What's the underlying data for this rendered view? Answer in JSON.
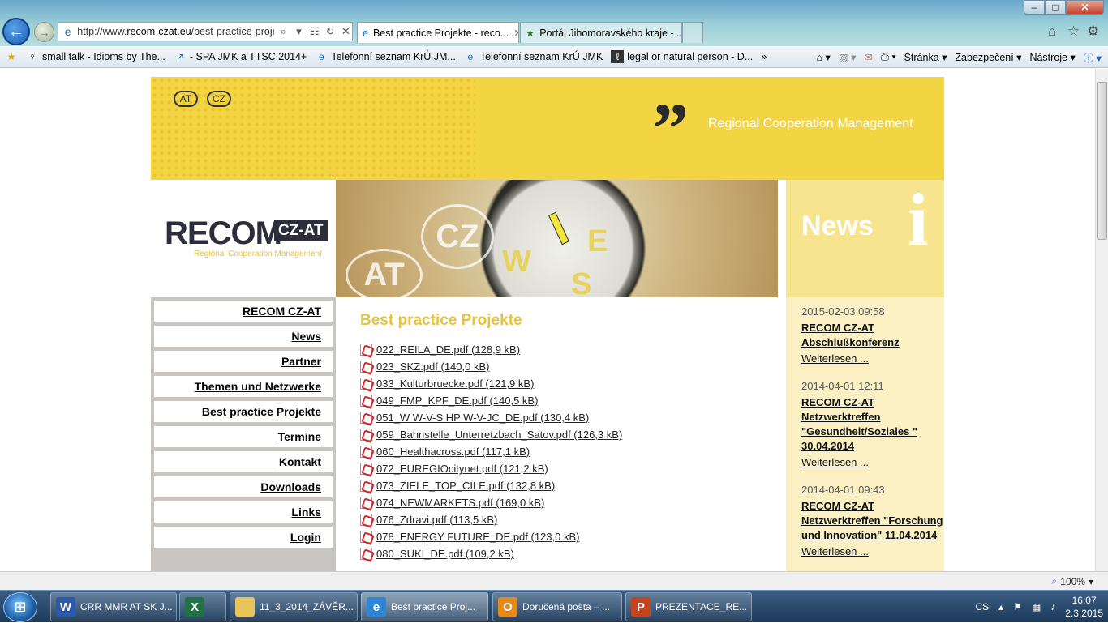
{
  "browser": {
    "url_prefix": "http://www.",
    "url_domain": "recom-czat.eu",
    "url_path": "/best-practice-projek",
    "tabs": [
      {
        "label": "Best practice Projekte - reco..."
      },
      {
        "label": "Portál Jihomoravského kraje - ..."
      }
    ],
    "favorites": [
      {
        "label": "small talk - Idioms by The..."
      },
      {
        "label": "- SPA JMK a TTSC 2014+"
      },
      {
        "label": "Telefonní seznam KrÚ JM..."
      },
      {
        "label": "Telefonní seznam KrÚ JMK"
      },
      {
        "label": "legal or natural person - D..."
      }
    ],
    "commands": {
      "page": "Stránka",
      "security": "Zabezpečení",
      "tools": "Nástroje"
    },
    "zoom": "100%"
  },
  "header": {
    "lang_at": "AT",
    "lang_cz": "CZ",
    "tagline": "Regional Cooperation Management",
    "logo_main": "RECOM",
    "logo_badge": "CZ-AT",
    "logo_sub": "Regional Cooperation Management",
    "news_heading": "News"
  },
  "sidebar": {
    "items": [
      {
        "label": "RECOM CZ-AT"
      },
      {
        "label": "News"
      },
      {
        "label": "Partner"
      },
      {
        "label": "Themen und Netzwerke"
      },
      {
        "label": "Best practice Projekte"
      },
      {
        "label": "Termine"
      },
      {
        "label": "Kontakt"
      },
      {
        "label": "Downloads"
      },
      {
        "label": "Links"
      },
      {
        "label": "Login"
      }
    ]
  },
  "main": {
    "title": "Best practice Projekte",
    "files": [
      "022_REILA_DE.pdf (128,9 kB)",
      "023_SKZ.pdf (140,0 kB)",
      "033_Kulturbruecke.pdf (121,9 kB)",
      "049_FMP_KPF_DE.pdf (140,5 kB)",
      "051_W W-V-S HP W-V-JC_DE.pdf (130,4 kB)",
      "059_Bahnstelle_Unterretzbach_Satov.pdf (126,3 kB)",
      "060_Healthacross.pdf (117,1 kB)",
      "072_EUREGIOcitynet.pdf (121,2 kB)",
      "073_ZIELE_TOP_CILE.pdf (132,8 kB)",
      "074_NEWMARKETS.pdf (169,0 kB)",
      "076_Zdravi.pdf (113,5 kB)",
      "078_ENERGY FUTURE_DE.pdf (123,0 kB)",
      "080_SUKI_DE.pdf (109,2 kB)"
    ]
  },
  "news": {
    "items": [
      {
        "date": "2015-02-03 09:58",
        "title": "RECOM CZ-AT Abschlußkonferenz",
        "more": "Weiterlesen ..."
      },
      {
        "date": "2014-04-01 12:11",
        "title": "RECOM CZ-AT Netzwerktreffen \"Gesundheit/Soziales \" 30.04.2014",
        "more": "Weiterlesen ..."
      },
      {
        "date": "2014-04-01 09:43",
        "title": "RECOM CZ-AT Netzwerktreffen \"Forschung und Innovation\" 11.04.2014",
        "more": "Weiterlesen ..."
      }
    ]
  },
  "taskbar": {
    "tasks": [
      {
        "label": "CRR MMR AT SK J..."
      },
      {
        "label": ""
      },
      {
        "label": "11_3_2014_ZÁVĚR..."
      },
      {
        "label": "Best practice Proj..."
      },
      {
        "label": "Doručená pošta – ..."
      },
      {
        "label": "PREZENTACE_RE..."
      }
    ],
    "lang": "CS",
    "time": "16:07",
    "date": "2.3.2015"
  }
}
